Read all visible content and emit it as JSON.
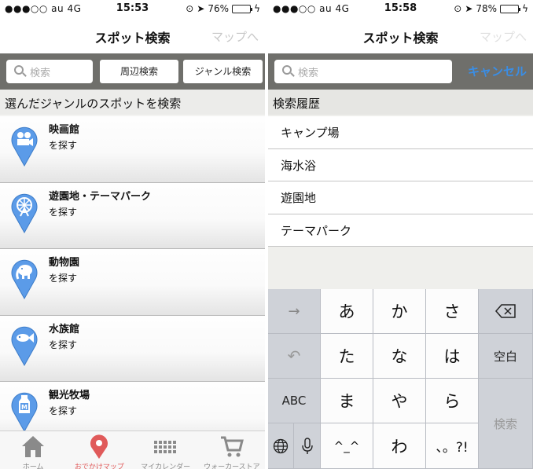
{
  "left": {
    "status": {
      "carrier": "●●●○○  au   4G",
      "time": "15:53",
      "battery": "76%",
      "battery_level": 0.76
    },
    "nav": {
      "title": "スポット検索",
      "right": "マップへ"
    },
    "toolbar": {
      "search_placeholder": "検索",
      "nearby_label": "周辺検索",
      "genre_label": "ジャンル検索"
    },
    "section_title": "選んだジャンルのスポットを検索",
    "spots": [
      {
        "name": "映画館",
        "sub": "を探す",
        "icon": "projector-icon"
      },
      {
        "name": "遊園地・テーマパーク",
        "sub": "を探す",
        "icon": "ferris-wheel-icon"
      },
      {
        "name": "動物園",
        "sub": "を探す",
        "icon": "elephant-icon"
      },
      {
        "name": "水族館",
        "sub": "を探す",
        "icon": "fish-icon"
      },
      {
        "name": "観光牧場",
        "sub": "を探す",
        "icon": "milk-bottle-icon"
      }
    ],
    "tabs": [
      {
        "label": "ホーム",
        "icon": "home-icon"
      },
      {
        "label": "おでかけマップ",
        "icon": "map-pin-icon",
        "active": true
      },
      {
        "label": "マイカレンダー",
        "icon": "calendar-grid-icon"
      },
      {
        "label": "ウォーカーストア",
        "icon": "cart-icon"
      }
    ]
  },
  "right": {
    "status": {
      "carrier": "●●●○○  au   4G",
      "time": "15:58",
      "battery": "78%",
      "battery_level": 0.78
    },
    "nav": {
      "title": "スポット検索",
      "right": "マップへ"
    },
    "toolbar": {
      "search_placeholder": "検索",
      "cancel_label": "キャンセル"
    },
    "section_title": "検索履歴",
    "history": [
      "キャンプ場",
      "海水浴",
      "遊園地",
      "テーマパーク"
    ],
    "keyboard": {
      "keys": [
        "あ",
        "か",
        "さ",
        "た",
        "な",
        "は",
        "ま",
        "や",
        "ら",
        "^_^",
        "わ",
        "、。?!"
      ],
      "abc": "ABC",
      "space": "空白",
      "search": "検索"
    }
  },
  "colors": {
    "accent_blue": "#3a8ee6",
    "pin_blue": "#5b9be8",
    "active_tab": "#e05a5a"
  }
}
